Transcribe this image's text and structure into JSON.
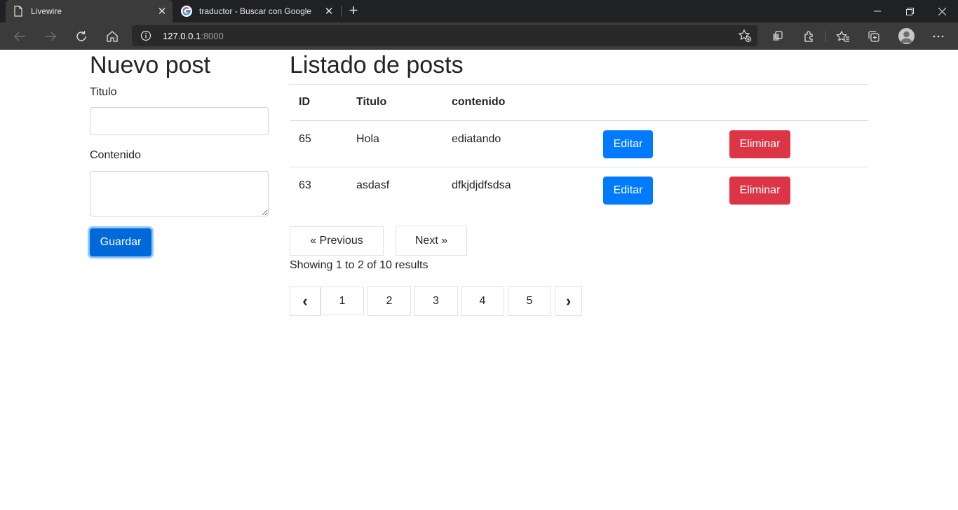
{
  "browser": {
    "tabs": [
      {
        "title": "Livewire",
        "icon": "page-icon"
      },
      {
        "title": "traductor - Buscar con Google",
        "icon": "google-icon"
      }
    ],
    "new_tab_symbol": "+",
    "address": {
      "host": "127.0.0.1",
      "port": ":8000"
    }
  },
  "form": {
    "title": "Nuevo post",
    "titulo_label": "Titulo",
    "titulo_value": "",
    "contenido_label": "Contenido",
    "contenido_value": "",
    "save_label": "Guardar"
  },
  "list": {
    "title": "Listado de posts",
    "columns": [
      "ID",
      "Titulo",
      "contenido"
    ],
    "rows": [
      {
        "id": "65",
        "titulo": "Hola",
        "contenido": "ediatando",
        "edit_label": "Editar",
        "delete_label": "Eliminar"
      },
      {
        "id": "63",
        "titulo": "asdasf",
        "contenido": "dfkjdjdfsdsa",
        "edit_label": "Editar",
        "delete_label": "Eliminar"
      }
    ]
  },
  "pagination": {
    "previous_label": "« Previous",
    "next_label": "Next »",
    "summary": "Showing 1 to 2 of 10 results",
    "prev_symbol": "‹",
    "next_symbol": "›",
    "pages": [
      "1",
      "2",
      "3",
      "4",
      "5"
    ]
  },
  "colors": {
    "primary": "#007bff",
    "danger": "#dc3545",
    "chrome_dark": "#202124",
    "chrome_toolbar": "#3b3b3b"
  }
}
